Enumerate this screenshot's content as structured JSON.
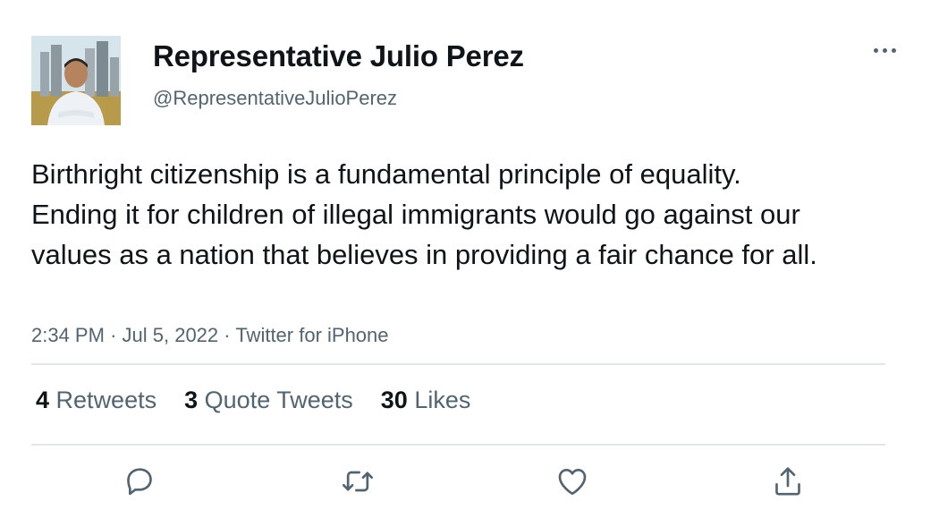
{
  "tweet": {
    "display_name": "Representative Julio Perez",
    "handle": "@RepresentativeJulioPerez",
    "text": "Birthright citizenship is a fundamental principle of equality. Ending it for children of illegal immigrants would go against our values as a nation that believes in providing a fair chance for all.",
    "time": "2:34 PM",
    "date": "Jul 5, 2022",
    "source": "Twitter for iPhone",
    "separator": "·"
  },
  "stats": {
    "retweets_count": "4",
    "retweets_label": "Retweets",
    "quotes_count": "3",
    "quotes_label": "Quote Tweets",
    "likes_count": "30",
    "likes_label": "Likes"
  },
  "icons": {
    "more": "more-dots-icon",
    "reply": "reply-icon",
    "retweet": "retweet-icon",
    "like": "like-icon",
    "share": "share-icon"
  },
  "colors": {
    "text": "#0f1419",
    "secondary": "#536471",
    "divider": "#e3e6e9"
  }
}
